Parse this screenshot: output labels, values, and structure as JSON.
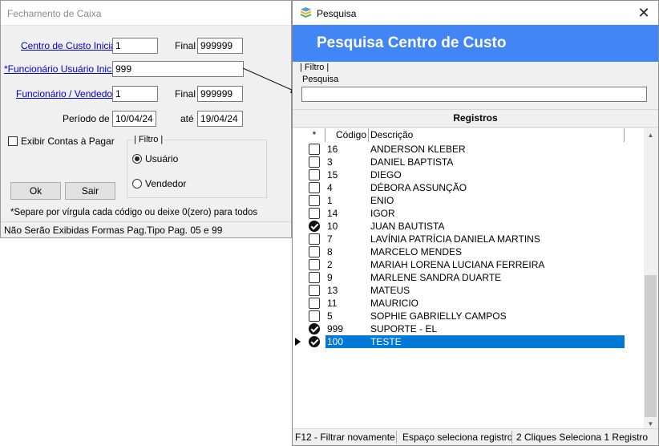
{
  "left_window": {
    "title": "Fechamento de Caixa",
    "centro_custo_label": "Centro de Custo Inicial",
    "centro_custo_value": "1",
    "final_label_1": "Final",
    "centro_custo_final": "999999",
    "funcionario_usuario_label": "*Funcionário Usuário Inicial",
    "funcionario_usuario_value": "999",
    "funcionario_vendedor_label": "Funcionário / Vendedor",
    "funcionario_vendedor_value": "1",
    "final_label_2": "Final",
    "funcionario_vendedor_final": "999999",
    "periodo_label": "Período de",
    "periodo_de": "10/04/24",
    "ate_label": "até",
    "periodo_ate": "19/04/24",
    "exibir_contas_label": "Exibir Contas à Pagar",
    "exibir_contas_checked": false,
    "filtro_group_label": "| Filtro |",
    "radio_usuario_label": "Usuário",
    "radio_vendedor_label": "Vendedor",
    "radio_selected": "usuario",
    "ok_label": "Ok",
    "sair_label": "Sair",
    "hint": "*Separe por vírgula cada código ou deixe 0(zero) para todos",
    "status": "Não Serão Exibidas Formas Pag.Tipo Pag. 05 e 99"
  },
  "right_window": {
    "title": "Pesquisa",
    "header": "Pesquisa Centro de Custo",
    "filtro_label": "| Filtro |",
    "pesquisa_label": "Pesquisa",
    "pesquisa_value": "",
    "registros_label": "Registros",
    "columns": {
      "check": "*",
      "codigo": "Código",
      "descricao": "Descrição"
    },
    "rows": [
      {
        "codigo": "16",
        "descricao": "ANDERSON KLEBER",
        "checked": false
      },
      {
        "codigo": "3",
        "descricao": "DANIEL BAPTISTA",
        "checked": false
      },
      {
        "codigo": "15",
        "descricao": "DIEGO",
        "checked": false
      },
      {
        "codigo": "4",
        "descricao": "DÉBORA ASSUNÇÃO",
        "checked": false
      },
      {
        "codigo": "1",
        "descricao": "ENIO",
        "checked": false
      },
      {
        "codigo": "14",
        "descricao": "IGOR",
        "checked": false
      },
      {
        "codigo": "10",
        "descricao": "JUAN BAUTISTA",
        "checked": true
      },
      {
        "codigo": "7",
        "descricao": "LAVÍNIA PATRÍCIA DANIELA MARTINS",
        "checked": false
      },
      {
        "codigo": "8",
        "descricao": "MARCELO MENDES",
        "checked": false
      },
      {
        "codigo": "2",
        "descricao": "MARIAH LORENA LUCIANA FERREIRA",
        "checked": false
      },
      {
        "codigo": "9",
        "descricao": "MARLENE SANDRA DUARTE",
        "checked": false
      },
      {
        "codigo": "13",
        "descricao": "MATEUS",
        "checked": false
      },
      {
        "codigo": "11",
        "descricao": "MAURICIO",
        "checked": false
      },
      {
        "codigo": "5",
        "descricao": "SOPHIE GABRIELLY CAMPOS",
        "checked": false
      },
      {
        "codigo": "999",
        "descricao": "SUPORTE - EL",
        "checked": true
      },
      {
        "codigo": "100",
        "descricao": "TESTE",
        "checked": true,
        "selected": true
      }
    ],
    "status": {
      "f12": "F12 - Filtrar novamente",
      "espaco": "Espaço seleciona registro",
      "cliques": "2 Cliques Seleciona 1 Registro"
    },
    "colors": {
      "header_bg": "#4285f4",
      "selection_bg": "#0078d7"
    },
    "icons": {
      "window": "database-icon",
      "close": "close-icon",
      "row_pointer": "row-pointer-icon"
    }
  }
}
